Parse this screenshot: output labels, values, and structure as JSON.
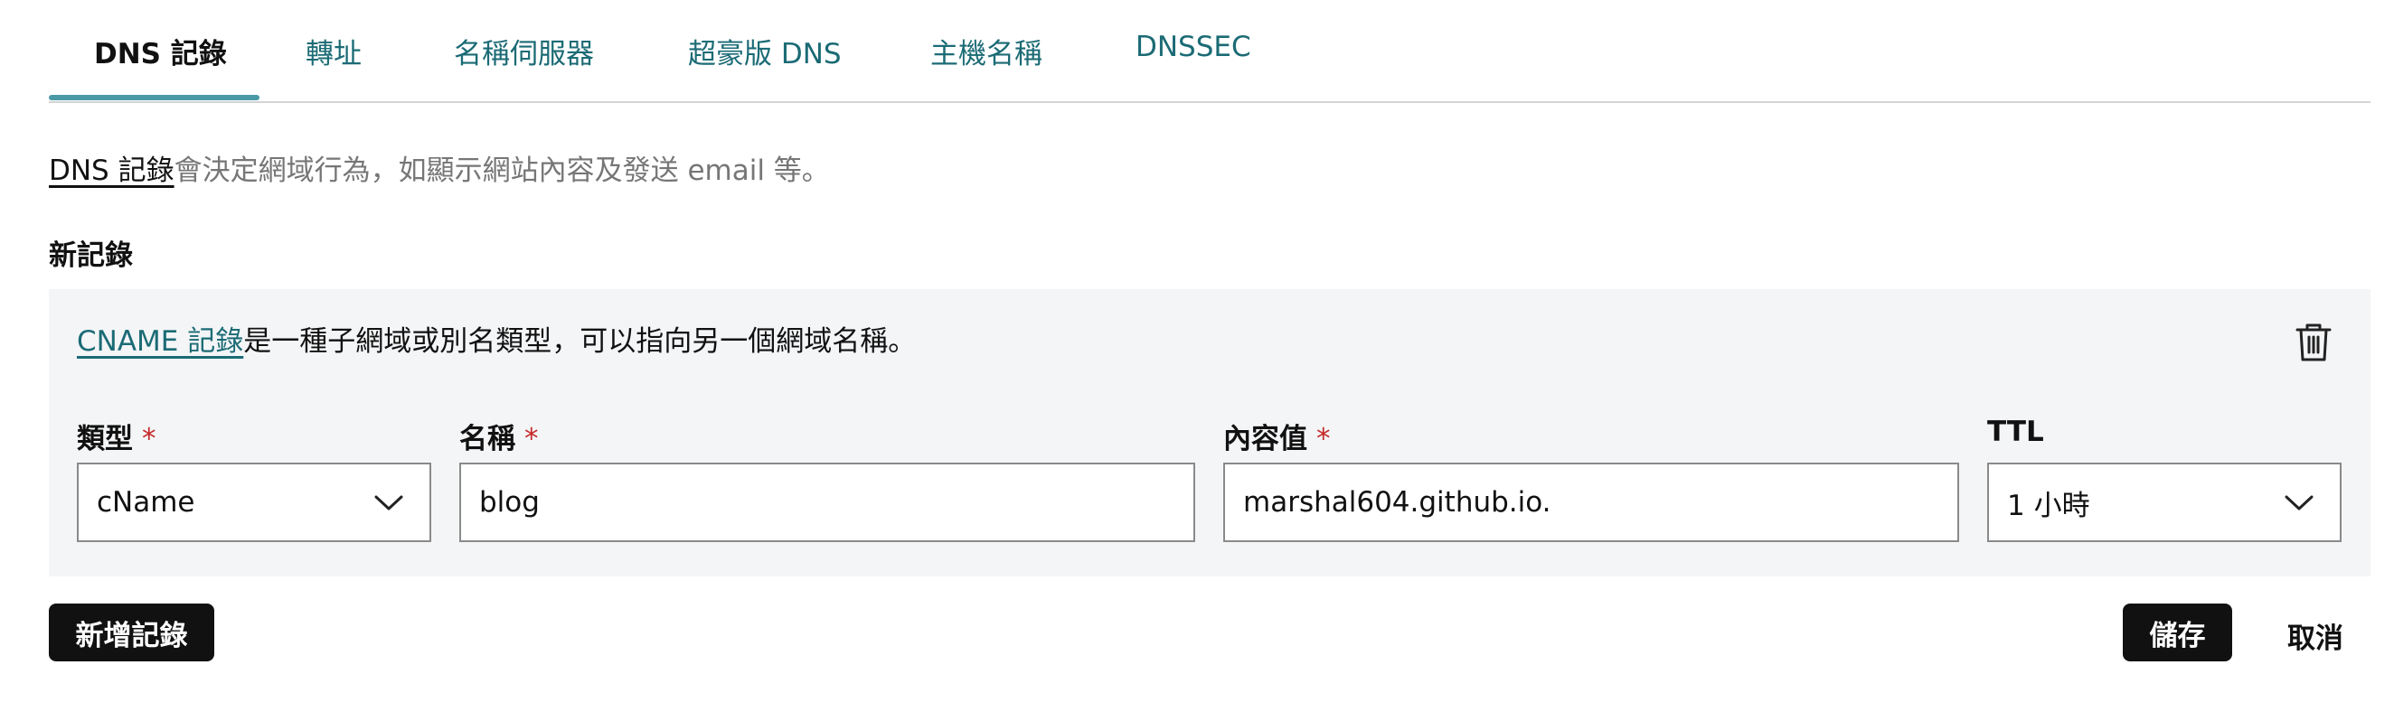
{
  "tabs": [
    {
      "label": "DNS 記錄",
      "active": true
    },
    {
      "label": "轉址",
      "active": false
    },
    {
      "label": "名稱伺服器",
      "active": false
    },
    {
      "label": "超豪版 DNS",
      "active": false
    },
    {
      "label": "主機名稱",
      "active": false
    },
    {
      "label": "DNSSEC",
      "active": false
    }
  ],
  "intro": {
    "link": "DNS 記錄",
    "text": "會決定網域行為，如顯示網站內容及發送 email 等。"
  },
  "new_record": {
    "title": "新記錄",
    "info_link": "CNAME 記錄",
    "info_text": "是一種子網域或別名類型，可以指向另一個網域名稱。",
    "delete_icon": "trash-icon",
    "fields": {
      "type": {
        "label": "類型",
        "required_mark": "*",
        "value": "cName"
      },
      "name": {
        "label": "名稱",
        "required_mark": "*",
        "value": "blog"
      },
      "content": {
        "label": "內容值",
        "required_mark": "*",
        "value": "marshal604.github.io."
      },
      "ttl": {
        "label": "TTL",
        "value": "1 小時"
      }
    }
  },
  "actions": {
    "add_record": "新增記錄",
    "save": "儲存",
    "cancel": "取消"
  },
  "colors": {
    "accent": "#1b6b75",
    "tab_underline": "#4a9aa6",
    "panel_bg": "#f4f5f7",
    "button_dark": "#111111",
    "required": "#c62828"
  }
}
